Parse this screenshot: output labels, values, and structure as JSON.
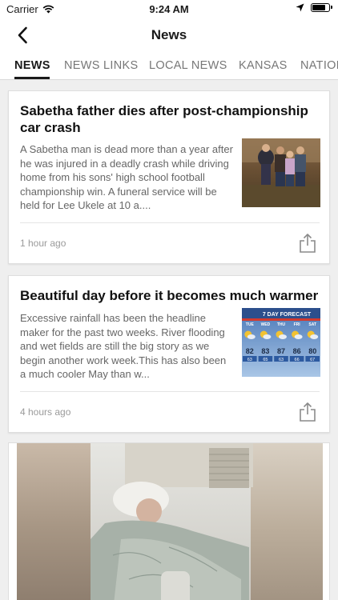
{
  "status_bar": {
    "carrier": "Carrier",
    "time": "9:24 AM",
    "battery_level": 0.85
  },
  "nav": {
    "title": "News",
    "back_icon": "chevron-left-icon"
  },
  "tabs": [
    {
      "label": "NEWS",
      "active": true
    },
    {
      "label": "NEWS LINKS",
      "active": false
    },
    {
      "label": "LOCAL NEWS",
      "active": false
    },
    {
      "label": "KANSAS",
      "active": false
    },
    {
      "label": "NATIONAL",
      "active": false
    }
  ],
  "articles": [
    {
      "headline": "Sabetha father dies after post-championship car crash",
      "summary": "A Sabetha man is dead more than a year after he was injured in a deadly crash while driving home from his sons' high school football championship win. A funeral service will be held for Lee Ukele at 10 a....",
      "timestamp": "1 hour ago",
      "share_icon": "share-icon"
    },
    {
      "headline": "Beautiful day before it becomes much warmer",
      "summary": "Excessive rainfall has been the headline maker for the past two weeks. River flooding and wet fields are still the big story as we begin another work week.This has also been a much cooler May than w...",
      "timestamp": "4 hours ago",
      "share_icon": "share-icon",
      "forecast": {
        "title": "7 DAY FORECAST",
        "days": [
          "TUE",
          "WED",
          "THU",
          "FRI",
          "SAT"
        ],
        "highs": [
          "82",
          "83",
          "87",
          "86",
          "80"
        ],
        "lows": [
          "63",
          "65",
          "63",
          "66",
          "67"
        ]
      }
    }
  ]
}
